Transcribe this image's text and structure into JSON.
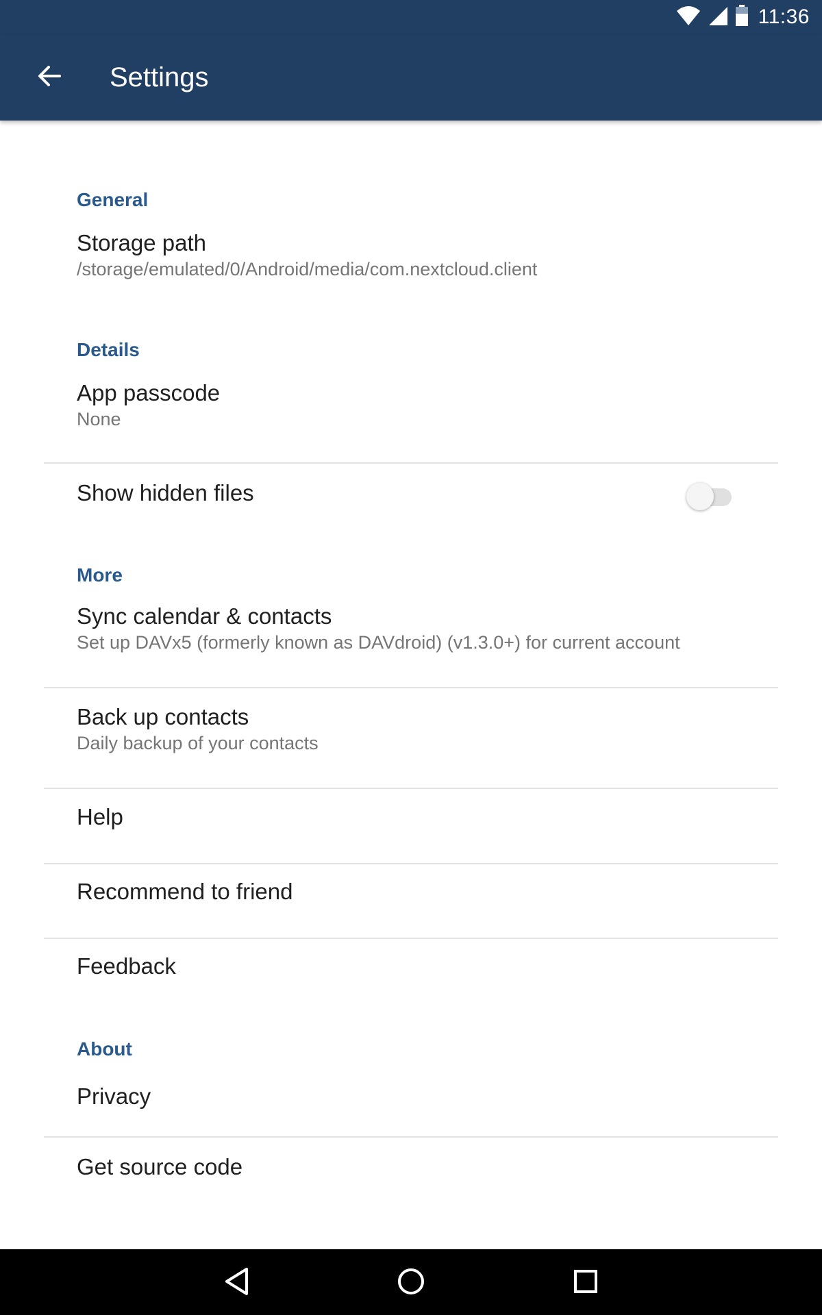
{
  "status_bar": {
    "time": "11:36",
    "icons": [
      "wifi-icon",
      "cell-signal-icon",
      "battery-icon"
    ]
  },
  "app_bar": {
    "title": "Settings",
    "back_icon": "arrow-back-icon"
  },
  "colors": {
    "app_bar": "#213f62",
    "section_header": "#2a5a8c",
    "nav_bar": "#000000"
  },
  "sections": {
    "general": {
      "header": "General",
      "storage_path": {
        "title": "Storage path",
        "summary": "/storage/emulated/0/Android/media/com.nextcloud.client"
      }
    },
    "details": {
      "header": "Details",
      "app_passcode": {
        "title": "App passcode",
        "summary": "None"
      },
      "show_hidden_files": {
        "title": "Show hidden files",
        "enabled": false
      }
    },
    "more": {
      "header": "More",
      "sync_calendar": {
        "title": "Sync calendar & contacts",
        "summary": "Set up DAVx5 (formerly known as DAVdroid) (v1.3.0+) for current account"
      },
      "backup_contacts": {
        "title": "Back up contacts",
        "summary": "Daily backup of your contacts"
      },
      "help": {
        "title": "Help"
      },
      "recommend": {
        "title": "Recommend to friend"
      },
      "feedback": {
        "title": "Feedback"
      }
    },
    "about": {
      "header": "About",
      "privacy": {
        "title": "Privacy"
      },
      "source_code": {
        "title": "Get source code"
      }
    }
  },
  "nav_bar": {
    "buttons": [
      "back-triangle-icon",
      "home-circle-icon",
      "recents-square-icon"
    ]
  }
}
